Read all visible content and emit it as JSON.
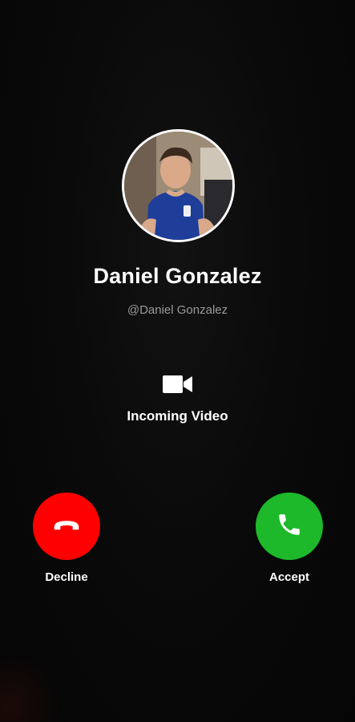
{
  "caller": {
    "name": "Daniel Gonzalez",
    "handle": "@Daniel Gonzalez",
    "avatar": "caller-photo"
  },
  "call": {
    "type_label": "Incoming Video",
    "type_icon": "video-camera-icon"
  },
  "actions": {
    "decline": {
      "label": "Decline",
      "icon": "phone-hangup-icon",
      "color": "#fe0000"
    },
    "accept": {
      "label": "Accept",
      "icon": "phone-icon",
      "color": "#1db92a"
    }
  },
  "theme": {
    "background": "#050505",
    "text": "#ffffff",
    "muted_text": "#9a9a9a"
  }
}
